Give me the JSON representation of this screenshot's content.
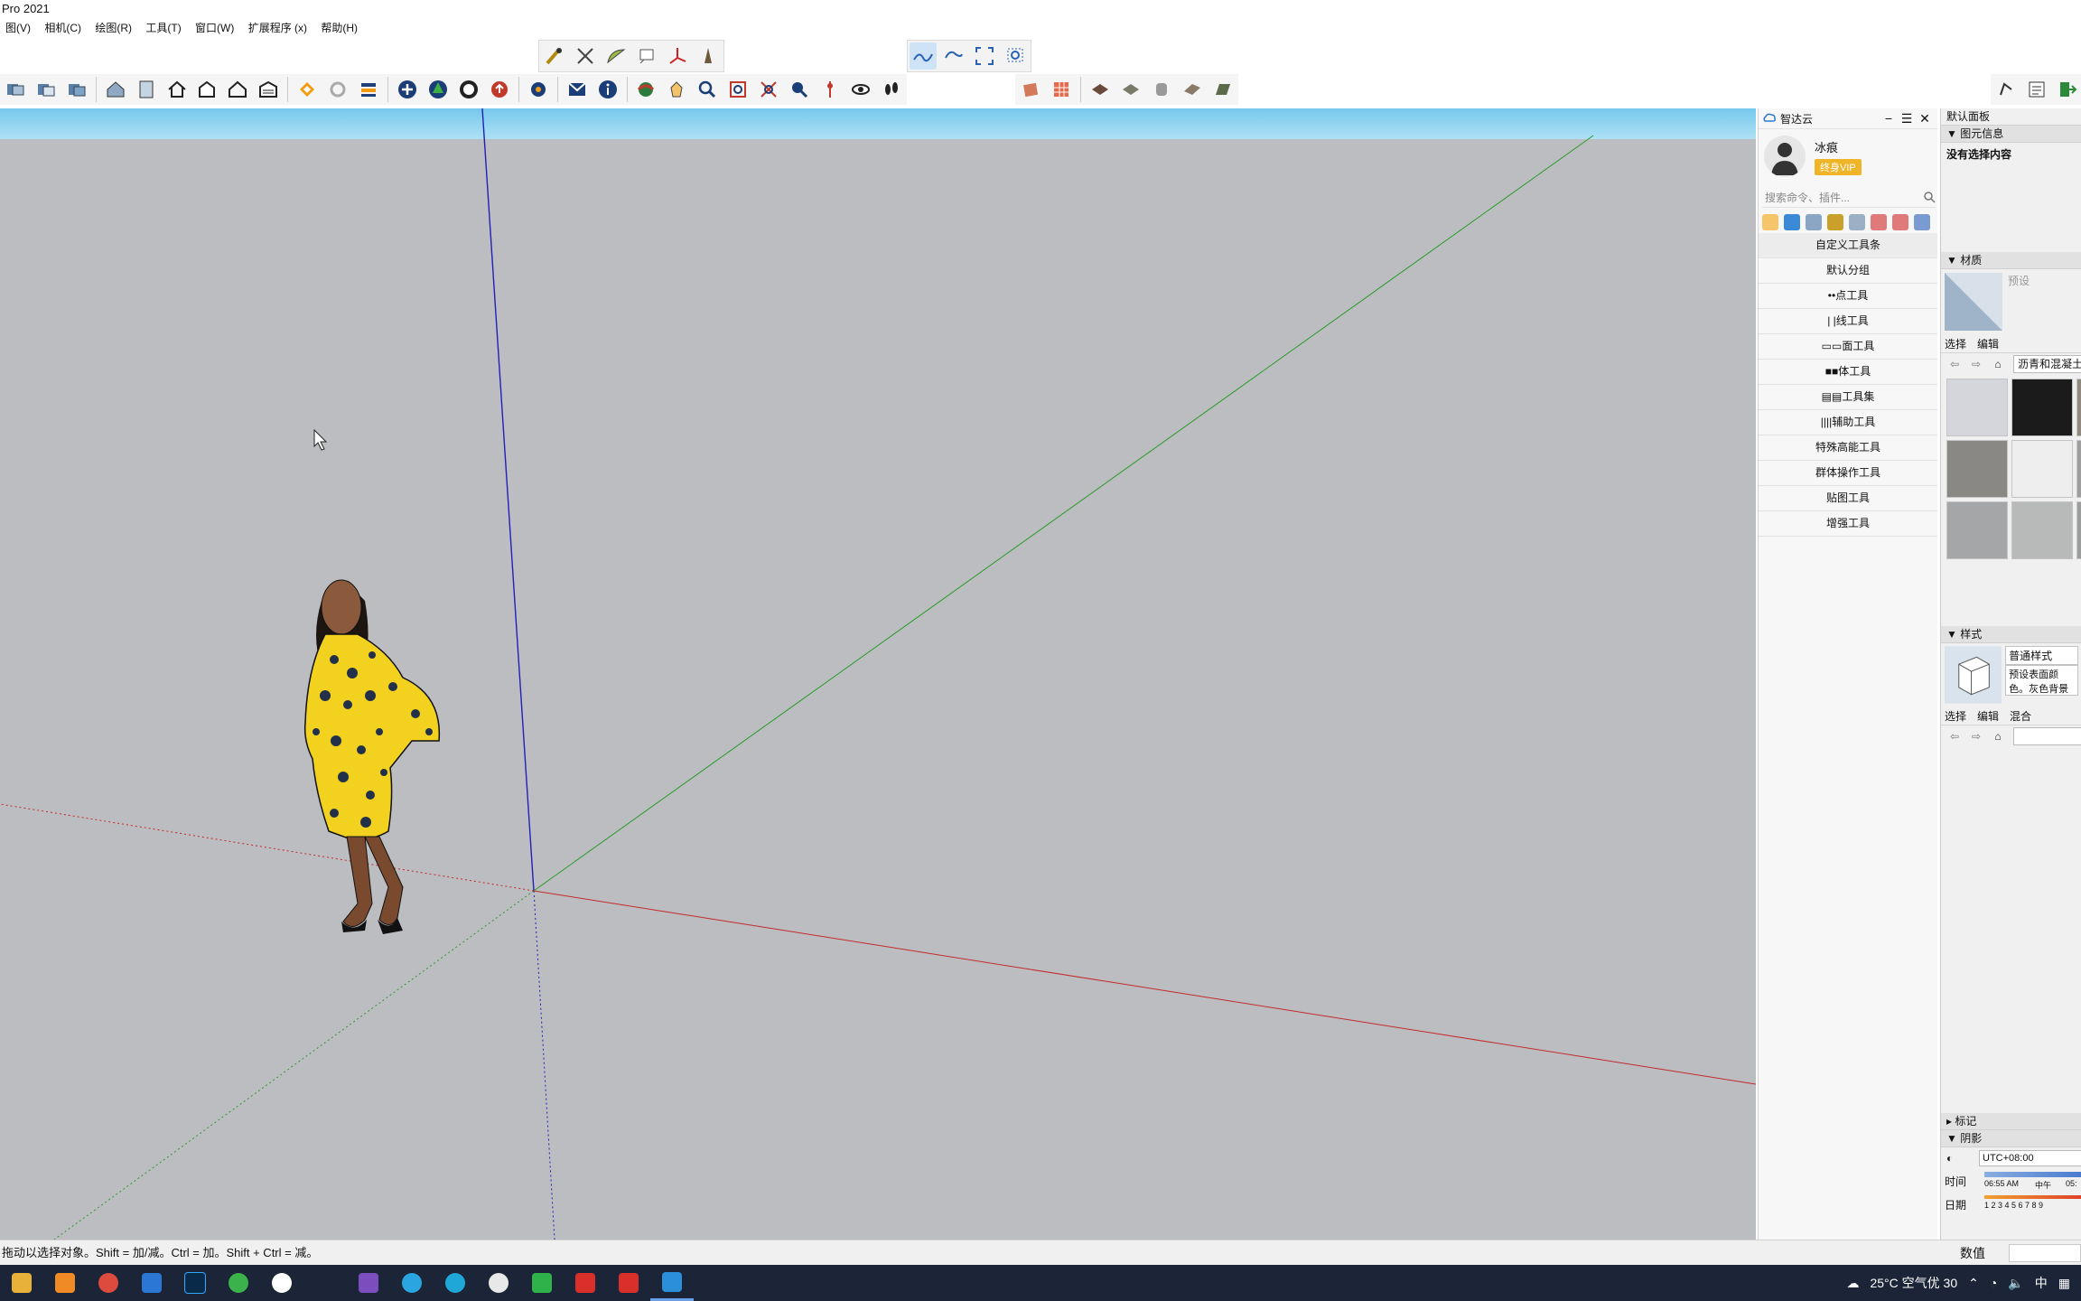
{
  "window": {
    "title": "Pro 2021"
  },
  "menu": [
    "图(V)",
    "相机(C)",
    "绘图(R)",
    "工具(T)",
    "窗口(W)",
    "扩展程序 (x)",
    "帮助(H)"
  ],
  "toolbar_top_icons": [
    "pencil-tool-icon",
    "tape-tool-icon",
    "protractor-icon",
    "text-tool-icon",
    "axes-tool-icon",
    "section-icon",
    "sandbox-smoove-icon",
    "sandbox-from-contour-icon",
    "zoom-extents-icon",
    "zoom-window-icon"
  ],
  "plugin_panel": {
    "title": "智达云",
    "user_name": "冰痕",
    "vip_badge": "终身VIP",
    "search_placeholder": "搜索命令、插件...",
    "groups": [
      "自定义工具条",
      "默认分组",
      "••点工具",
      "| |线工具",
      "▭▭面工具",
      "■■体工具",
      "▤▤工具集",
      "||||辅助工具",
      "特殊高能工具",
      "群体操作工具",
      "贴图工具",
      "增强工具"
    ]
  },
  "tray": {
    "title": "默认面板",
    "entity_info": {
      "header": "▼ 图元信息",
      "empty": "没有选择内容"
    },
    "materials": {
      "header": "▼ 材质",
      "preset": "预设",
      "tab_select": "选择",
      "tab_edit": "编辑",
      "library": "沥青和混凝土",
      "swatch_colors": [
        "#d4d6dc",
        "#1b1b1b",
        "#8e8a80",
        "#8a8884",
        "#eeeeee",
        "#9e9e9e",
        "#a4a6a8",
        "#b8bab9",
        "#9a9c9e"
      ]
    },
    "styles": {
      "header": "▼ 样式",
      "name": "普通样式",
      "desc": "预设表面颜色。灰色背景色。",
      "tab_select": "选择",
      "tab_edit": "编辑",
      "tab_mix": "混合"
    },
    "tags_header": "▸ 标记",
    "shadows": {
      "header": "▼ 阴影",
      "timezone": "UTC+08:00",
      "time_label": "时间",
      "time_start": "06:55 AM",
      "time_mid": "中午",
      "time_end": "05:",
      "date_label": "日期",
      "date_ticks": "1 2 3 4 5 6 7 8 9"
    }
  },
  "status": {
    "message": "拖动以选择对象。Shift = 加/减。Ctrl = 加。Shift + Ctrl = 减。",
    "value_label": "数值"
  },
  "taskbar": {
    "weather": "25°C 空气优 30",
    "ime": "中",
    "apps": [
      "explorer-icon",
      "search-icon",
      "chrome-icon",
      "calculator-icon",
      "photoshop-icon",
      "browser-icon",
      "settings-icon",
      "xbox-icon",
      "visual-studio-icon",
      "telegram-icon",
      "edge-icon",
      "chatbot-icon",
      "wechat-icon",
      "app-red-icon",
      "wps-icon",
      "sketchup-icon"
    ],
    "app_colors": [
      "#e7b13a",
      "#f08a24",
      "#dd4b3e",
      "#2b78d4",
      "#0a2a4a",
      "#3bb34a",
      "#ffffff",
      "#1b2537",
      "#7c4dbd",
      "#2aa5e0",
      "#1fa7d8",
      "#e8e8e8",
      "#2fb24a",
      "#d9302a",
      "#d9302a",
      "#2b8fd9"
    ]
  }
}
